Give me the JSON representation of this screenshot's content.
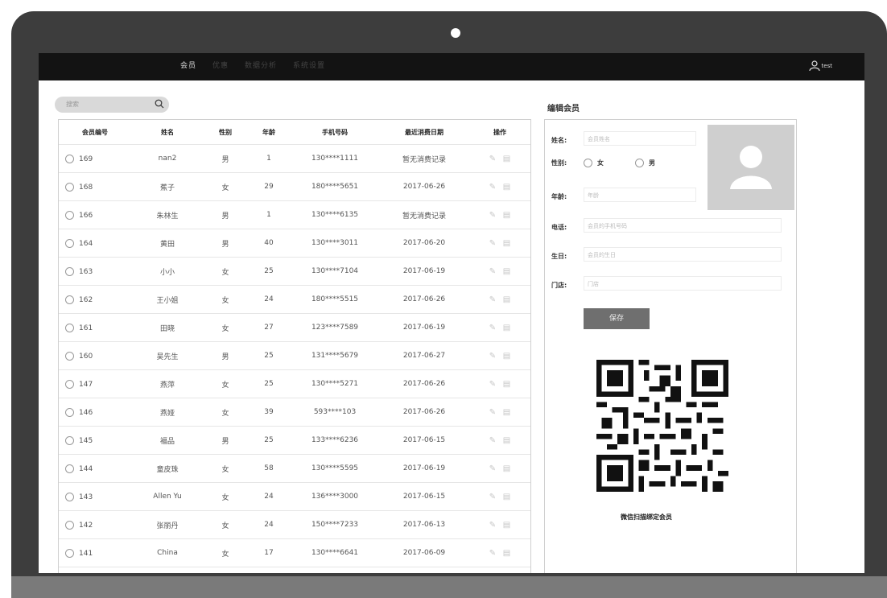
{
  "nav": {
    "items": [
      "会员",
      "优惠",
      "数据分析",
      "系统设置"
    ]
  },
  "user": {
    "name": "test"
  },
  "search": {
    "placeholder": "搜索"
  },
  "table": {
    "headers": [
      "会员编号",
      "姓名",
      "性别",
      "年龄",
      "手机号码",
      "最近消费日期",
      "操作"
    ],
    "rows": [
      [
        "169",
        "nan2",
        "男",
        "1",
        "130****1111",
        "暂无消费记录"
      ],
      [
        "168",
        "蕉子",
        "女",
        "29",
        "180****5651",
        "2017-06-26"
      ],
      [
        "166",
        "朱林生",
        "男",
        "1",
        "130****6135",
        "暂无消费记录"
      ],
      [
        "164",
        "黄田",
        "男",
        "40",
        "130****3011",
        "2017-06-20"
      ],
      [
        "163",
        "小小",
        "女",
        "25",
        "130****7104",
        "2017-06-19"
      ],
      [
        "162",
        "王小姐",
        "女",
        "24",
        "180****5515",
        "2017-06-26"
      ],
      [
        "161",
        "田晓",
        "女",
        "27",
        "123****7589",
        "2017-06-19"
      ],
      [
        "160",
        "吴先生",
        "男",
        "25",
        "131****5679",
        "2017-06-27"
      ],
      [
        "147",
        "燕萍",
        "女",
        "25",
        "130****5271",
        "2017-06-26"
      ],
      [
        "146",
        "燕娅",
        "女",
        "39",
        "593****103",
        "2017-06-26"
      ],
      [
        "145",
        "福品",
        "男",
        "25",
        "133****6236",
        "2017-06-15"
      ],
      [
        "144",
        "童皮珠",
        "女",
        "58",
        "130****5595",
        "2017-06-19"
      ],
      [
        "143",
        "Allen Yu",
        "女",
        "24",
        "136****3000",
        "2017-06-15"
      ],
      [
        "142",
        "张丽丹",
        "女",
        "24",
        "150****7233",
        "2017-06-13"
      ],
      [
        "141",
        "China",
        "女",
        "17",
        "130****6641",
        "2017-06-09"
      ]
    ]
  },
  "panel": {
    "title": "编辑会员",
    "name_label": "姓名:",
    "name_placeholder": "会员姓名",
    "gender_label": "性别:",
    "gender_female": "女",
    "gender_male": "男",
    "age_label": "年龄:",
    "age_placeholder": "年龄",
    "phone_label": "电话:",
    "phone_placeholder": "会员的手机号码",
    "birthday_label": "生日:",
    "birthday_placeholder": "会员的生日",
    "store_label": "门店:",
    "store_placeholder": "门店",
    "save_label": "保存",
    "qr_caption": "微信扫描绑定会员"
  }
}
